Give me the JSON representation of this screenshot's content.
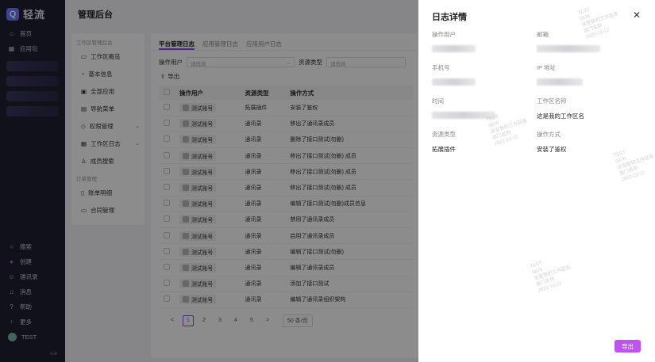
{
  "app": {
    "logo_text": "轻流"
  },
  "left_nav": {
    "top_items": [
      {
        "label": "首页",
        "icon": "home-icon"
      },
      {
        "label": "应用包",
        "icon": "grid-icon"
      }
    ],
    "bottom_items": [
      {
        "label": "搜索",
        "icon": "search-icon"
      },
      {
        "label": "创建",
        "icon": "plus-circle-icon"
      },
      {
        "label": "通讯录",
        "icon": "contacts-icon"
      },
      {
        "label": "消息",
        "icon": "bell-icon"
      },
      {
        "label": "帮助",
        "icon": "help-icon"
      },
      {
        "label": "更多",
        "icon": "more-grid-icon"
      }
    ],
    "user": "TEST"
  },
  "admin": {
    "title": "管理后台",
    "sidebar": {
      "group1": "工作区管理后台",
      "items1": [
        "工作区概览",
        "基本信息",
        "全部应用",
        "导航菜单",
        "权限管理",
        "工作区日志",
        "成员搜索"
      ],
      "group2": "订单管理",
      "items2": [
        "账单明细",
        "合同管理"
      ]
    },
    "tabs": [
      "平台管理日志",
      "应用管理日志",
      "应用用户日志"
    ],
    "filters": {
      "user_label": "操作用户",
      "user_placeholder": "请选择",
      "resource_label": "资源类型",
      "resource_placeholder": "请选择"
    },
    "export_label": "导出",
    "table": {
      "headers": [
        "操作用户",
        "资源类型",
        "操作方式"
      ],
      "rows": [
        [
          "测试账号",
          "拓展插件",
          "安装了鉴权"
        ],
        [
          "测试账号",
          "通讯录",
          "移出了通讯录成员"
        ],
        [
          "测试账号",
          "通讯录",
          "删除了接口测试(勿删)"
        ],
        [
          "测试账号",
          "通讯录",
          "移出了接口测试(勿删) 成员"
        ],
        [
          "测试账号",
          "通讯录",
          "移出了接口测试(勿删) 成员"
        ],
        [
          "测试账号",
          "通讯录",
          "移出了接口测试(勿删) 成员"
        ],
        [
          "测试账号",
          "通讯录",
          "编辑了接口测试(勿删)成员信息"
        ],
        [
          "测试账号",
          "通讯录",
          "禁用了通讯录成员"
        ],
        [
          "测试账号",
          "通讯录",
          "启用了通讯录成员"
        ],
        [
          "测试账号",
          "通讯录",
          "编辑了接口测试(勿删)"
        ],
        [
          "测试账号",
          "通讯录",
          "编辑了通讯录成员"
        ],
        [
          "测试账号",
          "通讯录",
          "添加了接口测试"
        ],
        [
          "测试账号",
          "通讯录",
          "编辑了通讯录组织架构"
        ]
      ]
    },
    "pager": {
      "prev": "<",
      "pages": [
        "1",
        "2",
        "3",
        "4",
        "5"
      ],
      "next": ">",
      "page_size": "50 条/页"
    }
  },
  "drawer": {
    "title": "日志详情",
    "fields": {
      "operator_label": "操作用户",
      "email_label": "邮箱",
      "phone_label": "手机号",
      "ip_label": "IP 地址",
      "time_label": "时间",
      "workspace_label": "工作区名称",
      "workspace_value": "这是我的工作区名",
      "resource_label": "资源类型",
      "resource_value": "拓展插件",
      "action_label": "操作方式",
      "action_value": "安装了鉴权"
    },
    "export_button": "导出"
  },
  "watermark": "TEST\n0876\n这是我的工作区名\n部门名称\n2022-10-12",
  "colors": {
    "accent": "#c252f0",
    "nav_bg": "#1f1f33",
    "tab_underline": "#8a4bf2"
  }
}
